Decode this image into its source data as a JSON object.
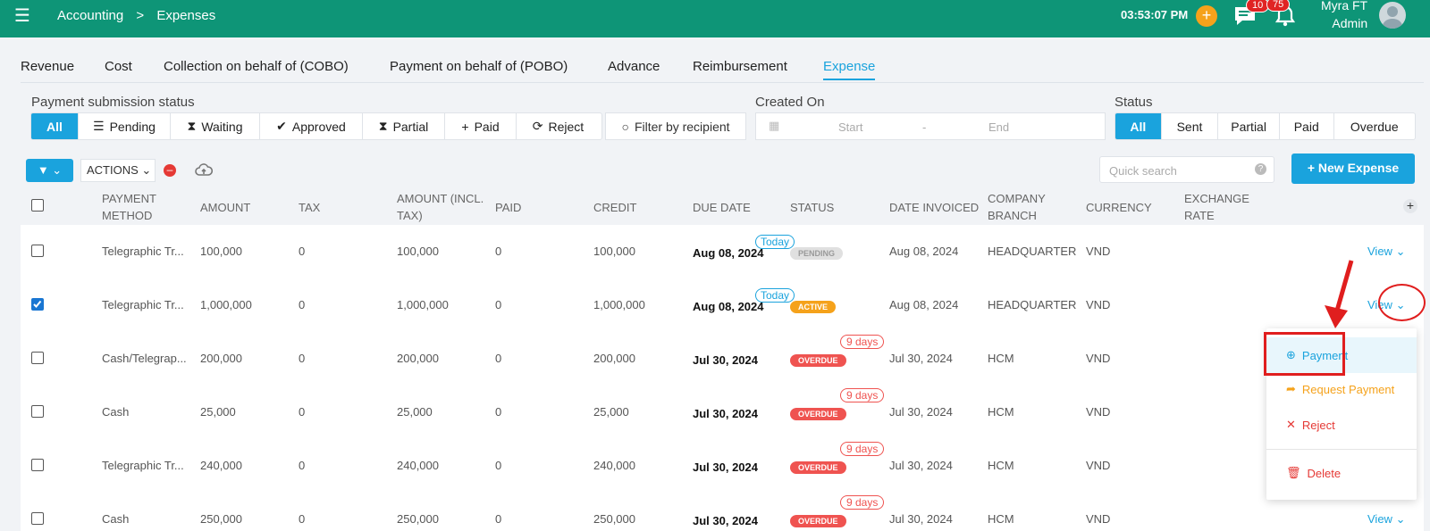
{
  "topbar": {
    "breadcrumb": [
      "Accounting",
      ">",
      "Expenses"
    ],
    "clock": "03:53:07 PM",
    "chat_count": "10",
    "notif_count": "75",
    "user_name": "Myra FT",
    "user_role": "Admin",
    "bg_color": "#0e9577"
  },
  "tabs": [
    "Revenue",
    "Cost",
    "Collection on behalf of (COBO)",
    "Payment on behalf of (POBO)",
    "Advance",
    "Reimbursement",
    "Expense"
  ],
  "active_tab": "Expense",
  "filters": {
    "submission_label": "Payment submission status",
    "submission_options": [
      {
        "label": "All",
        "icon": ""
      },
      {
        "label": "Pending",
        "icon": "list-icon"
      },
      {
        "label": "Waiting",
        "icon": "hourglass-icon"
      },
      {
        "label": "Approved",
        "icon": "check-icon"
      },
      {
        "label": "Partial",
        "icon": "hourglass-icon"
      },
      {
        "label": "Paid",
        "icon": "plus-icon"
      },
      {
        "label": "Reject",
        "icon": "refresh-icon"
      }
    ],
    "recipient_label": "Filter by recipient",
    "created_label": "Created On",
    "date_start": "Start",
    "date_sep": "-",
    "date_end": "End",
    "status_label": "Status",
    "status_options": [
      "All",
      "Sent",
      "Partial",
      "Paid",
      "Overdue"
    ]
  },
  "toolbar": {
    "actions_label": "ACTIONS",
    "search_placeholder": "Quick search",
    "new_expense_label": "+ New Expense",
    "accent": "#1aa3dd"
  },
  "columns": [
    "PAYMENT METHOD",
    "AMOUNT",
    "TAX",
    "AMOUNT (INCL. TAX)",
    "PAID",
    "CREDIT",
    "DUE DATE",
    "STATUS",
    "DATE INVOICED",
    "COMPANY BRANCH",
    "CURRENCY",
    "EXCHANGE RATE"
  ],
  "rows": [
    {
      "checked": false,
      "method": "Telegraphic Tr...",
      "amount": "100,000",
      "tax": "0",
      "incl": "100,000",
      "paid": "0",
      "credit": "100,000",
      "due": "Aug 08, 2024",
      "due_tag": "Today",
      "status": "PENDING",
      "invoiced": "Aug 08, 2024",
      "branch": "HEADQUARTER",
      "currency": "VND",
      "view": "View"
    },
    {
      "checked": true,
      "method": "Telegraphic Tr...",
      "amount": "1,000,000",
      "tax": "0",
      "incl": "1,000,000",
      "paid": "0",
      "credit": "1,000,000",
      "due": "Aug 08, 2024",
      "due_tag": "Today",
      "status": "ACTIVE",
      "invoiced": "Aug 08, 2024",
      "branch": "HEADQUARTER",
      "currency": "VND",
      "view": "View"
    },
    {
      "checked": false,
      "method": "Cash/Telegrap...",
      "amount": "200,000",
      "tax": "0",
      "incl": "200,000",
      "paid": "0",
      "credit": "200,000",
      "due": "Jul 30, 2024",
      "due_tag": "9 days",
      "status": "OVERDUE",
      "invoiced": "Jul 30, 2024",
      "branch": "HCM",
      "currency": "VND",
      "view": ""
    },
    {
      "checked": false,
      "method": "Cash",
      "amount": "25,000",
      "tax": "0",
      "incl": "25,000",
      "paid": "0",
      "credit": "25,000",
      "due": "Jul 30, 2024",
      "due_tag": "9 days",
      "status": "OVERDUE",
      "invoiced": "Jul 30, 2024",
      "branch": "HCM",
      "currency": "VND",
      "view": ""
    },
    {
      "checked": false,
      "method": "Telegraphic Tr...",
      "amount": "240,000",
      "tax": "0",
      "incl": "240,000",
      "paid": "0",
      "credit": "240,000",
      "due": "Jul 30, 2024",
      "due_tag": "9 days",
      "status": "OVERDUE",
      "invoiced": "Jul 30, 2024",
      "branch": "HCM",
      "currency": "VND",
      "view": ""
    },
    {
      "checked": false,
      "method": "Cash",
      "amount": "250,000",
      "tax": "0",
      "incl": "250,000",
      "paid": "0",
      "credit": "250,000",
      "due": "Jul 30, 2024",
      "due_tag": "9 days",
      "status": "OVERDUE",
      "invoiced": "Jul 30, 2024",
      "branch": "HCM",
      "currency": "VND",
      "view": "View"
    }
  ],
  "status_colors": {
    "PENDING": "#e0e0e0",
    "ACTIVE": "#f5a21b",
    "OVERDUE": "#ef5350"
  },
  "dropdown": {
    "items": [
      {
        "label": "Payment",
        "icon": "plus-circle-icon",
        "color": "#1aa3dd"
      },
      {
        "label": "Request Payment",
        "icon": "share-arrow-icon",
        "color": "#f5a21b"
      },
      {
        "label": "Reject",
        "icon": "x-icon",
        "color": "#e53935"
      },
      {
        "label": "Delete",
        "icon": "trash-icon",
        "color": "#e53935"
      }
    ]
  }
}
